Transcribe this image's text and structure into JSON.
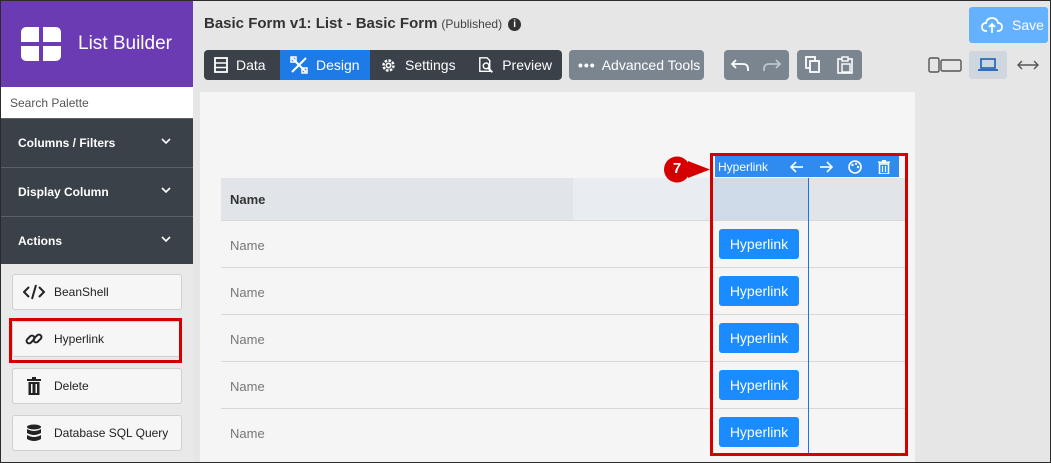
{
  "app": {
    "title": "List Builder"
  },
  "header": {
    "title": "Basic Form v1: List - Basic Form",
    "status": "(Published)",
    "info_glyph": "i",
    "save_label": "Save"
  },
  "tabs": [
    {
      "label": "Data",
      "active": false,
      "icon": "database-icon"
    },
    {
      "label": "Design",
      "active": true,
      "icon": "design-tools-icon"
    },
    {
      "label": "Settings",
      "active": false,
      "icon": "gear-icon"
    },
    {
      "label": "Preview",
      "active": false,
      "icon": "preview-icon"
    }
  ],
  "advanced": {
    "dots": "•••",
    "label": "Advanced Tools"
  },
  "sidebar": {
    "search_placeholder": "Search Palette",
    "sections": [
      "Columns / Filters",
      "Display Column",
      "Actions"
    ],
    "items": [
      {
        "label": "BeanShell",
        "icon": "code-icon",
        "highlighted": false
      },
      {
        "label": "Hyperlink",
        "icon": "link-icon",
        "highlighted": true
      },
      {
        "label": "Delete",
        "icon": "trash-icon",
        "highlighted": false
      },
      {
        "label": "Database SQL Query",
        "icon": "database-icon",
        "highlighted": false
      }
    ]
  },
  "table": {
    "header_name": "Name",
    "rows": [
      {
        "name": "Name",
        "action": "Hyperlink"
      },
      {
        "name": "Name",
        "action": "Hyperlink"
      },
      {
        "name": "Name",
        "action": "Hyperlink"
      },
      {
        "name": "Name",
        "action": "Hyperlink"
      },
      {
        "name": "Name",
        "action": "Hyperlink"
      }
    ]
  },
  "column_toolbar": {
    "label": "Hyperlink",
    "icons": [
      "arrow-left-icon",
      "arrow-right-icon",
      "palette-icon",
      "trash-icon"
    ]
  },
  "callout": {
    "number": "7"
  },
  "colors": {
    "brand": "#6a3bb3",
    "accent": "#1e7ae6",
    "highlight": "#d40000",
    "link_button": "#1a8cff"
  }
}
